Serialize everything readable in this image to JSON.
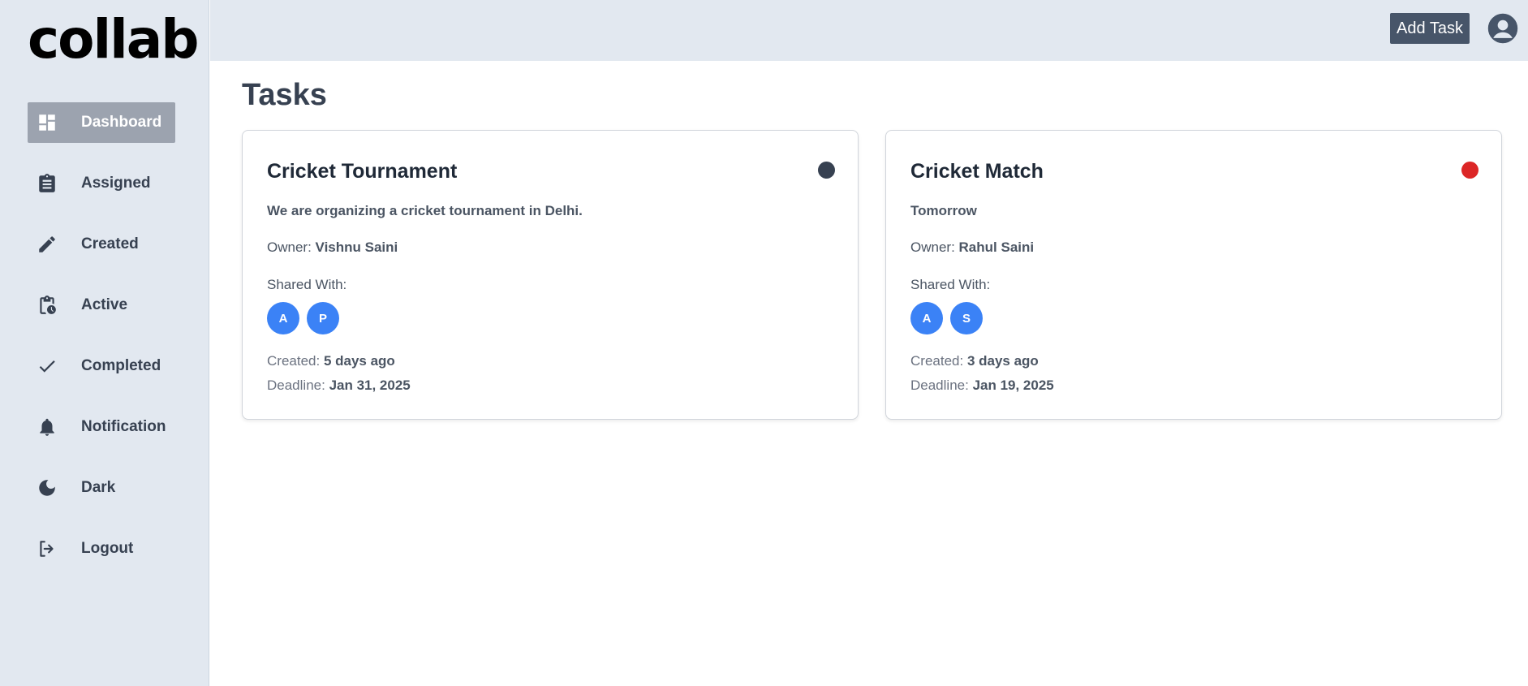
{
  "app": {
    "logo_text": "collab"
  },
  "sidebar": {
    "items": [
      {
        "label": "Dashboard",
        "icon": "dashboard-icon",
        "active": true
      },
      {
        "label": "Assigned",
        "icon": "clipboard-icon"
      },
      {
        "label": "Created",
        "icon": "pencil-icon"
      },
      {
        "label": "Active",
        "icon": "clipboard-clock-icon"
      },
      {
        "label": "Completed",
        "icon": "check-icon"
      },
      {
        "label": "Notification",
        "icon": "bell-icon"
      },
      {
        "label": "Dark",
        "icon": "moon-icon"
      },
      {
        "label": "Logout",
        "icon": "logout-icon"
      }
    ]
  },
  "header": {
    "add_task_label": "Add Task",
    "user_icon": "user-circle-icon"
  },
  "main": {
    "title": "Tasks",
    "tasks": [
      {
        "title": "Cricket Tournament",
        "status_color": "#374151",
        "description": "We are organizing a cricket tournament in Delhi.",
        "owner_label": "Owner:",
        "owner": "Vishnu Saini",
        "shared_label": "Shared With:",
        "shared_with": [
          "A",
          "P"
        ],
        "created_label": "Created:",
        "created": "5 days ago",
        "deadline_label": "Deadline:",
        "deadline": "Jan 31, 2025"
      },
      {
        "title": "Cricket Match",
        "status_color": "#dc2626",
        "description": "Tomorrow",
        "owner_label": "Owner:",
        "owner": "Rahul Saini",
        "shared_label": "Shared With:",
        "shared_with": [
          "A",
          "S"
        ],
        "created_label": "Created:",
        "created": "3 days ago",
        "deadline_label": "Deadline:",
        "deadline": "Jan 19, 2025"
      }
    ]
  },
  "colors": {
    "sidebar_bg": "#e2e8f0",
    "active_nav": "#9ca3af",
    "button_bg": "#475569",
    "avatar_bg": "#3b82f6"
  }
}
